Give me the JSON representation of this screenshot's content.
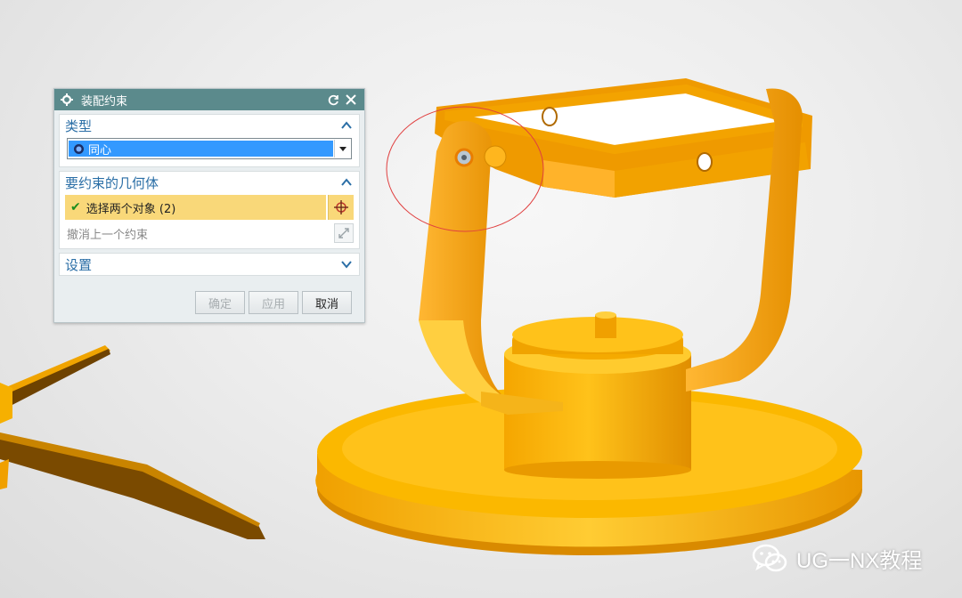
{
  "dialog": {
    "title": "装配约束",
    "sections": {
      "type": {
        "label": "类型",
        "selected": "同心"
      },
      "geometry": {
        "label": "要约束的几何体",
        "select_objects": "选择两个对象 (2)",
        "undo_last": "撤消上一个约束"
      },
      "settings": {
        "label": "设置"
      }
    },
    "buttons": {
      "ok": "确定",
      "apply": "应用",
      "cancel": "取消"
    }
  },
  "watermark": {
    "text": "UG一NX教程",
    "icon": "wechat-icon"
  },
  "colors": {
    "title_bar": "#5b8a8c",
    "section_label": "#2a6ea6",
    "selection_highlight": "#3399ff",
    "active_field": "#f9d879",
    "model_orange": "#f2a200"
  }
}
